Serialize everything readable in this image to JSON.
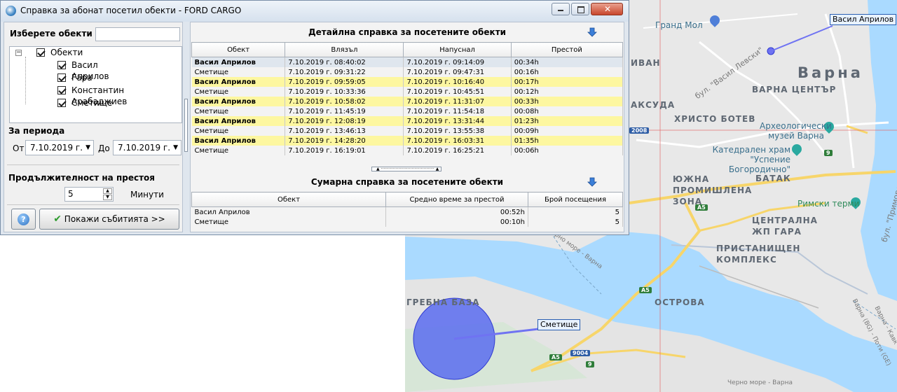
{
  "window": {
    "title": "Справка за абонат посетил обекти  -  FORD CARGO",
    "controls": {
      "minimize": "minimize-icon",
      "maximize": "maximize-icon",
      "close": "close-icon"
    }
  },
  "filter": {
    "select_objects_label": "Изберете обекти",
    "search_value": "",
    "tree": {
      "root": "Обекти",
      "children": [
        "Васил Априлов",
        "Гара",
        "Константин Арабаджиев",
        "Сметище"
      ]
    },
    "period_label": "За периода",
    "from_label": "От",
    "from_value": "7.10.2019 г.",
    "to_label": "До",
    "to_value": "7.10.2019 г.",
    "duration_label": "Продължителност на престоя",
    "duration_value": "5",
    "duration_unit": "Минути",
    "help_button": "?",
    "show_button": "Покажи събитията >>"
  },
  "detail": {
    "title": "Детайлна справка за посетените обекти",
    "columns": [
      "Обект",
      "Влязъл",
      "Напуснал",
      "Престой"
    ],
    "rows": [
      [
        "Васил Априлов",
        "7.10.2019 г. 08:40:02",
        "7.10.2019 г. 09:14:09",
        "00:34h"
      ],
      [
        "Сметище",
        "7.10.2019 г. 09:31:22",
        "7.10.2019 г. 09:47:31",
        "00:16h"
      ],
      [
        "Васил Априлов",
        "7.10.2019 г. 09:59:05",
        "7.10.2019 г. 10:16:40",
        "00:17h"
      ],
      [
        "Сметище",
        "7.10.2019 г. 10:33:36",
        "7.10.2019 г. 10:45:51",
        "00:12h"
      ],
      [
        "Васил Априлов",
        "7.10.2019 г. 10:58:02",
        "7.10.2019 г. 11:31:07",
        "00:33h"
      ],
      [
        "Сметище",
        "7.10.2019 г. 11:45:19",
        "7.10.2019 г. 11:54:18",
        "00:08h"
      ],
      [
        "Васил Априлов",
        "7.10.2019 г. 12:08:19",
        "7.10.2019 г. 13:31:44",
        "01:23h"
      ],
      [
        "Сметище",
        "7.10.2019 г. 13:46:13",
        "7.10.2019 г. 13:55:38",
        "00:09h"
      ],
      [
        "Васил Априлов",
        "7.10.2019 г. 14:28:20",
        "7.10.2019 г. 16:03:31",
        "01:35h"
      ],
      [
        "Сметище",
        "7.10.2019 г. 16:19:01",
        "7.10.2019 г. 16:25:21",
        "00:06h"
      ]
    ]
  },
  "summary": {
    "title": "Сумарна справка за посетените обекти",
    "columns": [
      "Обект",
      "Средно време за престой",
      "Брой посещения"
    ],
    "rows": [
      [
        "Васил Априлов",
        "00:52h",
        "5"
      ],
      [
        "Сметище",
        "00:10h",
        "5"
      ]
    ]
  },
  "map": {
    "city": "Варна",
    "districts": [
      "ВАРНА ЦЕНТЪР",
      "ХРИСТО БОТЕВ",
      "АКСУДА",
      "ИВАН",
      "БАТАК",
      "ЮЖНА ПРОМИШЛЕНА ЗОНА",
      "ЦЕНТРАЛНА ЖП ГАРА",
      "ПРИСТАНИЩЕН КОМПЛЕКС",
      "ОСТРОВА",
      "ГРЕБНА БАЗА"
    ],
    "pois": [
      "Гранд Мол",
      "Археологически музей Варна",
      "Катедрален храм \"Успение Богородично\"",
      "Римски терми"
    ],
    "roads": [
      "бул. \"Васил Левски\"",
      "бул. \"Приморски\"",
      "Черно море - Варна",
      "Черно море - Варна",
      "Варна (BG) - Поти (GE)",
      "Варна - Кавк"
    ],
    "shields": [
      "2008",
      "9",
      "A5",
      "A5",
      "9004",
      "A5",
      "9"
    ],
    "callouts": [
      "Васил Априлов",
      "Сметище"
    ],
    "colors": {
      "zone_fill": "#5b6cf0",
      "water": "#aadaff",
      "land": "#e8e8e8",
      "road": "#f7d56a"
    }
  }
}
